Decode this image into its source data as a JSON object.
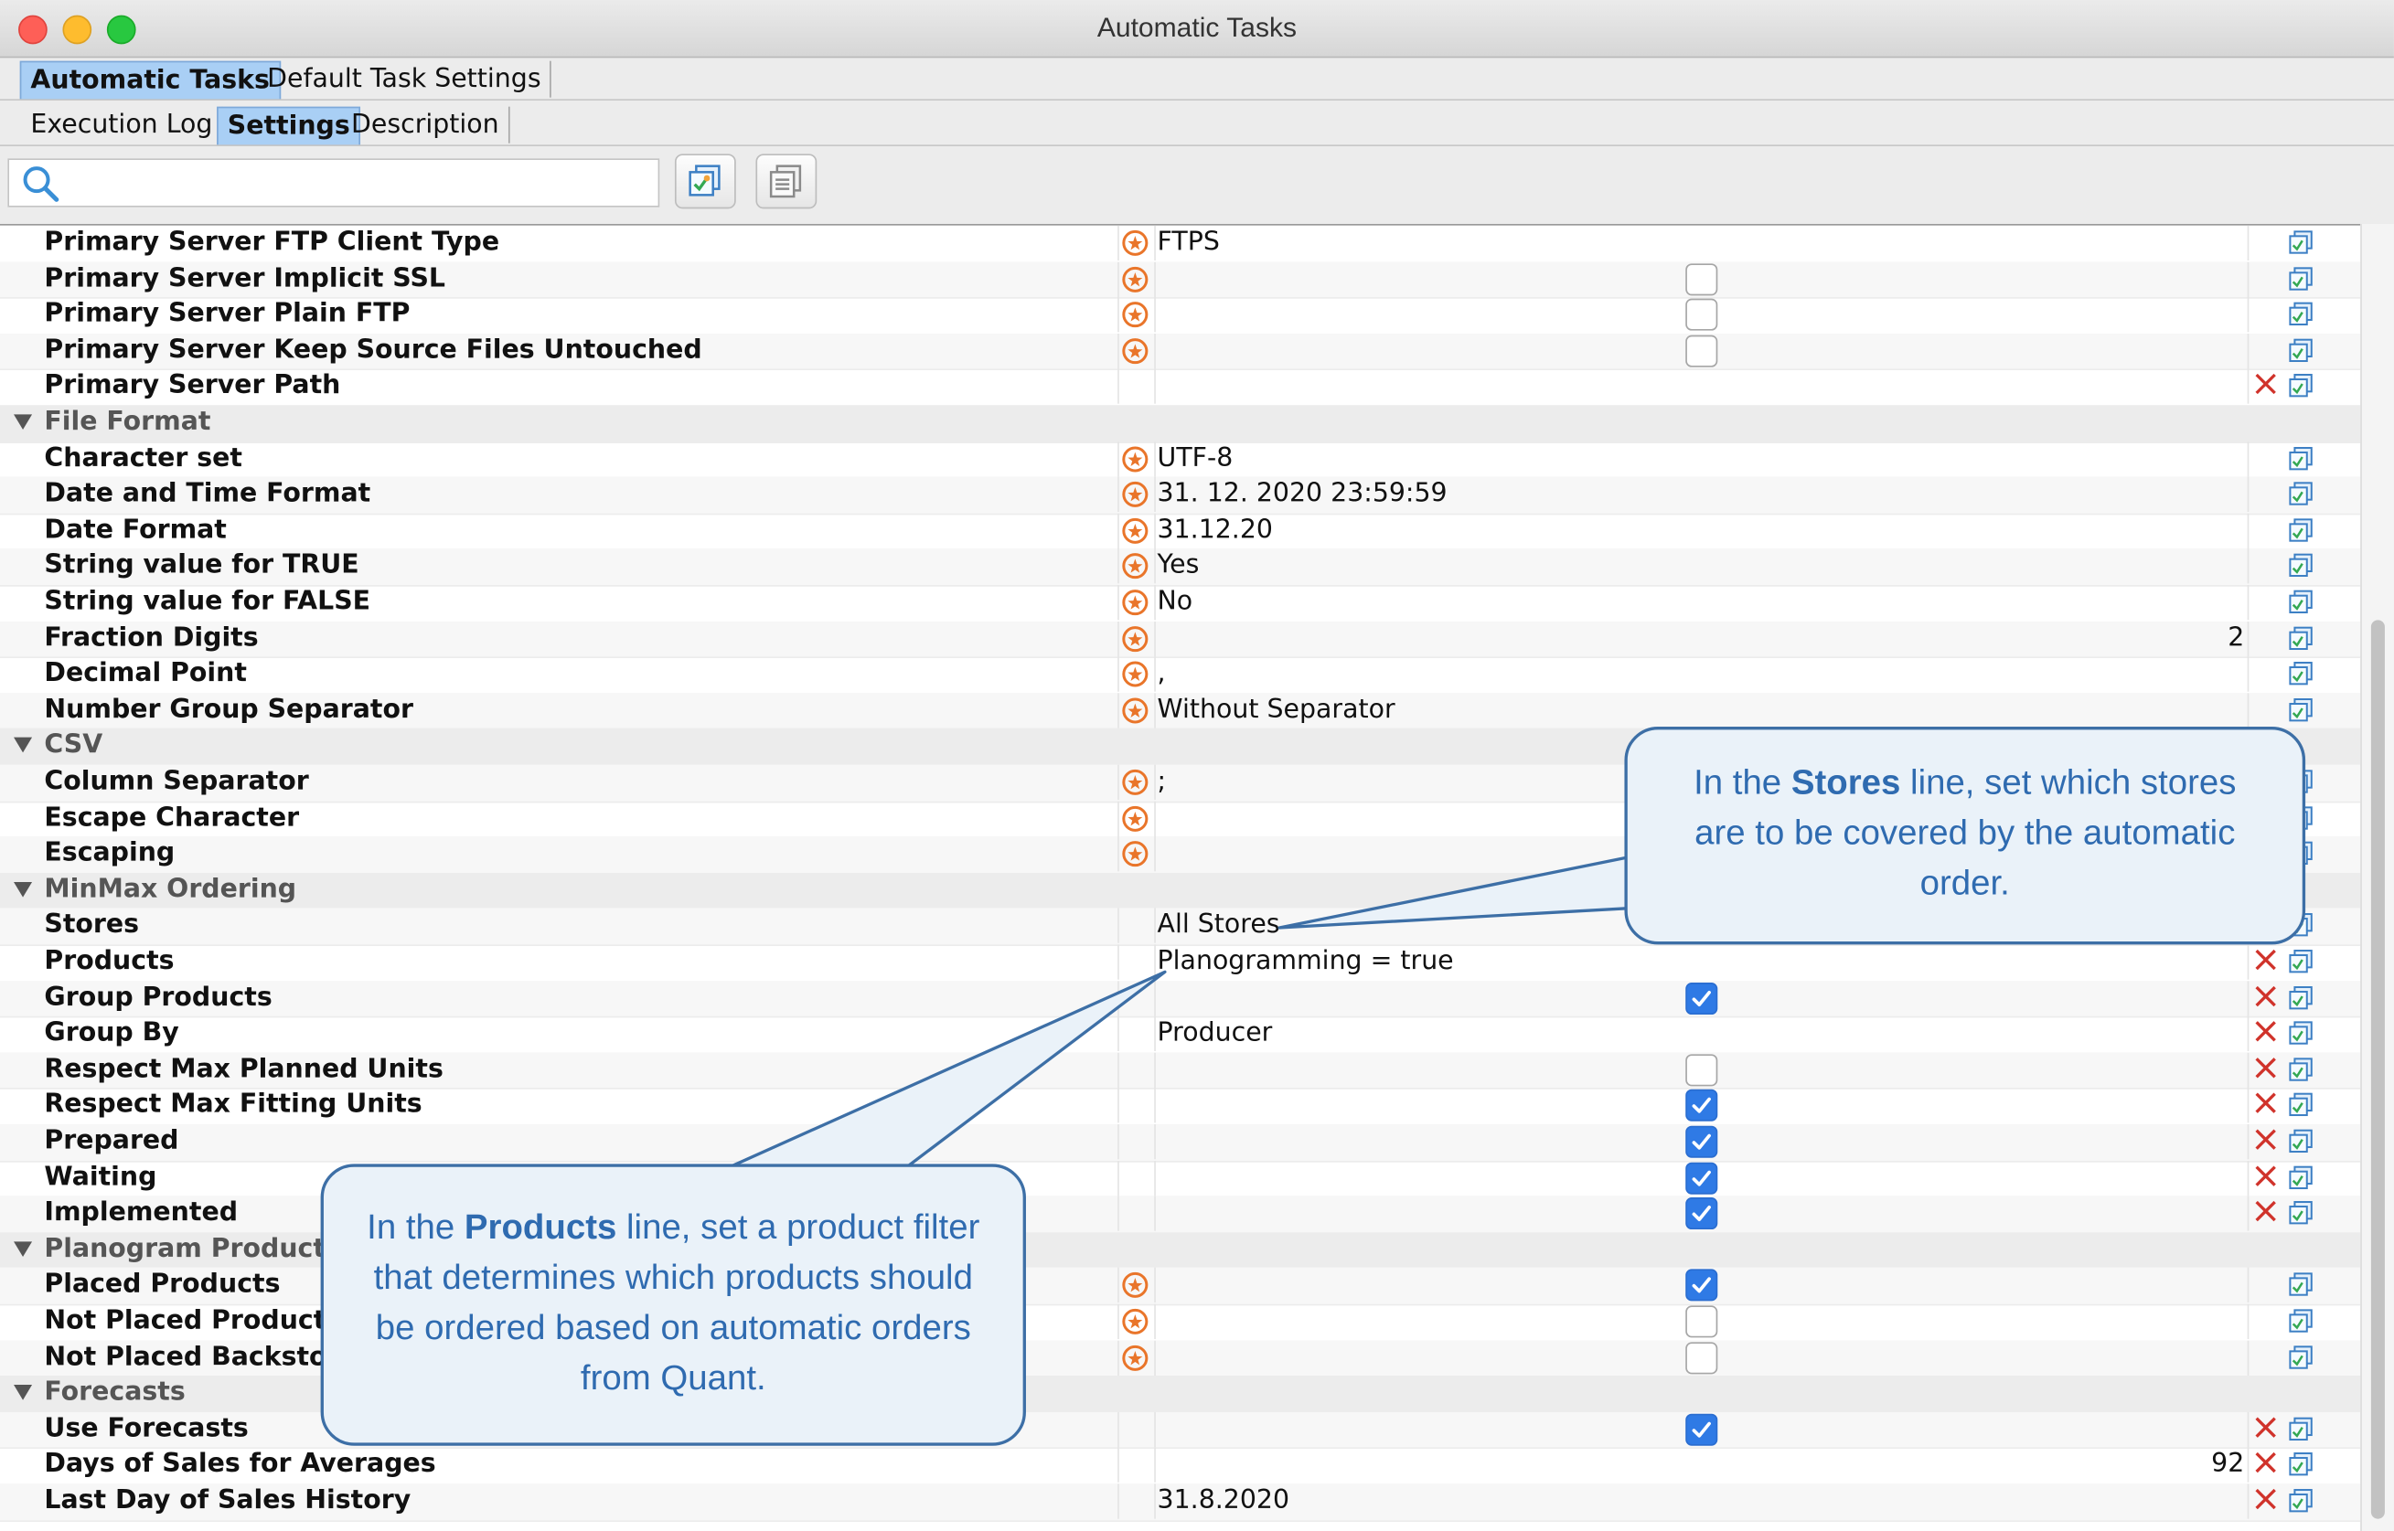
{
  "window": {
    "title": "Automatic Tasks"
  },
  "tabs_primary": [
    {
      "label": "Automatic Tasks",
      "active": true
    },
    {
      "label": "Default Task Settings",
      "active": false
    }
  ],
  "tabs_secondary": [
    {
      "label": "Execution Log",
      "active": false
    },
    {
      "label": "Settings",
      "active": true
    },
    {
      "label": "Description",
      "active": false
    }
  ],
  "search": {
    "placeholder": ""
  },
  "toolbar": {
    "icons": [
      "search-icon",
      "apply-settings-icon",
      "copy-settings-icon"
    ]
  },
  "rows": [
    {
      "label": "Primary Server FTP Client Type",
      "value": "FTPS"
    },
    {
      "label": "Primary Server Implicit SSL",
      "checked": false
    },
    {
      "label": "Primary Server Plain FTP",
      "checked": false
    },
    {
      "label": "Primary Server Keep Source Files Untouched",
      "checked": false
    },
    {
      "label": "Primary Server Path",
      "value": ""
    },
    {
      "label": "File Format",
      "group": true
    },
    {
      "label": "Character set",
      "value": "UTF-8"
    },
    {
      "label": "Date and Time Format",
      "value": "31. 12. 2020 23:59:59"
    },
    {
      "label": "Date Format",
      "value": "31.12.20"
    },
    {
      "label": "String value for TRUE",
      "value": "Yes"
    },
    {
      "label": "String value for FALSE",
      "value": "No"
    },
    {
      "label": "Fraction Digits",
      "number": "2"
    },
    {
      "label": "Decimal Point",
      "value": ","
    },
    {
      "label": "Number Group Separator",
      "value": "Without Separator"
    },
    {
      "label": "CSV",
      "group": true
    },
    {
      "label": "Column Separator",
      "value": ";"
    },
    {
      "label": "Escape Character",
      "value": ""
    },
    {
      "label": "Escaping",
      "value": ""
    },
    {
      "label": "MinMax Ordering",
      "group": true
    },
    {
      "label": "Stores",
      "value": "All Stores"
    },
    {
      "label": "Products",
      "value": "Planogramming = true"
    },
    {
      "label": "Group Products",
      "checked": true
    },
    {
      "label": "Group By",
      "value": "Producer"
    },
    {
      "label": "Respect Max Planned Units",
      "checked": false
    },
    {
      "label": "Respect Max Fitting Units",
      "checked": true
    },
    {
      "label": "Prepared",
      "checked": true
    },
    {
      "label": "Waiting",
      "checked": true
    },
    {
      "label": "Implemented",
      "checked": true
    },
    {
      "label": "Planogram Products",
      "group": true
    },
    {
      "label": "Placed Products",
      "checked": true
    },
    {
      "label": "Not Placed Products",
      "checked": false
    },
    {
      "label": "Not Placed Backstoc",
      "checked": false
    },
    {
      "label": "Forecasts",
      "group": true
    },
    {
      "label": "Use Forecasts",
      "checked": true
    },
    {
      "label": "Days of Sales for Averages",
      "number": "92"
    },
    {
      "label": "Last Day of Sales History",
      "value": "31.8.2020"
    }
  ],
  "callouts": {
    "stores": {
      "pre": "In the ",
      "bold": "Stores",
      "post": " line, set which stores are to be covered by the automatic order."
    },
    "products": {
      "pre": "In the ",
      "bold": "Products",
      "post": " line, set a product filter that determines which products should be ordered based on automatic orders from Quant."
    }
  },
  "colors": {
    "accent": "#2f7ae5",
    "callout_text": "#2f6bb0",
    "callout_border": "#3d6fa6",
    "delete": "#d0332b",
    "star": "#e9752a"
  }
}
